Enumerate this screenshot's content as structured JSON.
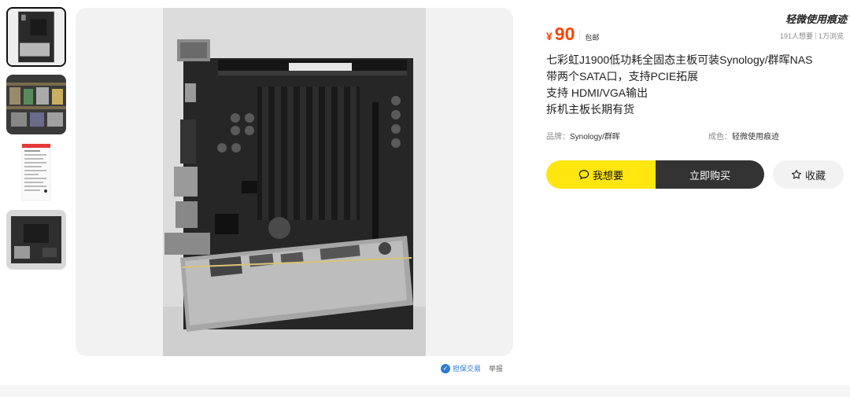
{
  "thumbnails": [
    {
      "name": "motherboard-front",
      "active": true
    },
    {
      "name": "shelf-photo",
      "active": false
    },
    {
      "name": "spec-screenshot",
      "active": false
    },
    {
      "name": "motherboard-angle",
      "active": false
    }
  ],
  "image_footer": {
    "protect_label": "担保交易",
    "report_label": "举报"
  },
  "price": {
    "currency": "¥",
    "amount": "90",
    "shipping": "包邮",
    "color": "#ff4400"
  },
  "condition_tag": "轻微使用痕迹",
  "stats": {
    "wants": "191人想要",
    "views": "1万浏览"
  },
  "title_lines": [
    "七彩虹J1900低功耗全固态主板可装Synology/群晖NAS",
    "带两个SATA口，支持PCIE拓展",
    "支持 HDMI/VGA输出",
    "拆机主板长期有货"
  ],
  "attributes": {
    "brand_label": "品牌：",
    "brand_value": "Synology/群晖",
    "condition_label": "成色：",
    "condition_value": "轻微使用痕迹"
  },
  "buttons": {
    "want": "我想要",
    "buy": "立即购买",
    "favorite": "收藏"
  },
  "icons": {
    "want": "chat-icon",
    "favorite": "star-icon",
    "protect": "shield-icon"
  },
  "colors": {
    "accent_yellow": "#ffe60f",
    "buy_dark": "#333333"
  }
}
